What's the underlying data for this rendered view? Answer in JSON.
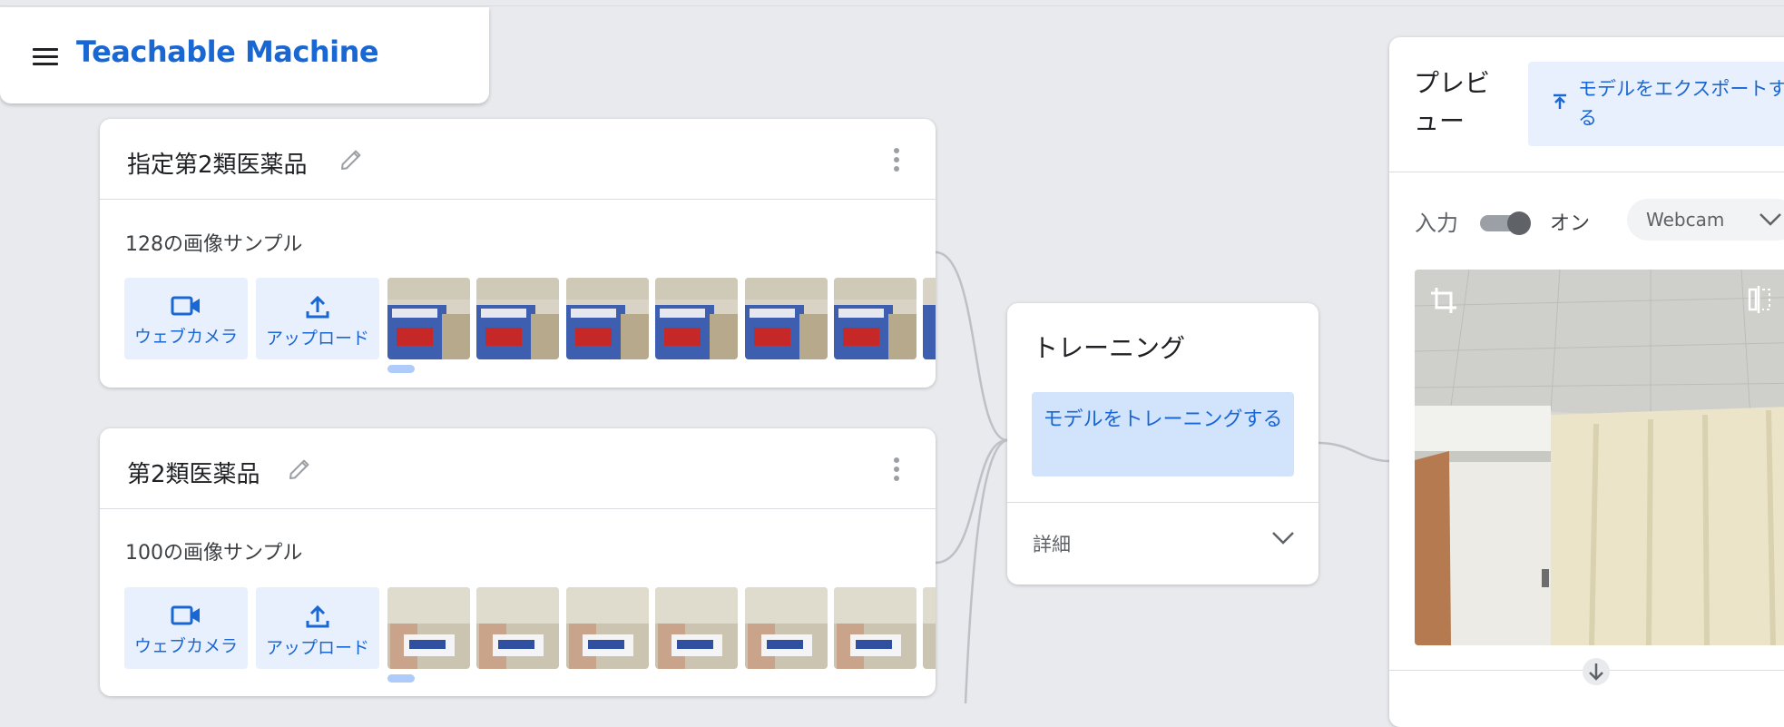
{
  "app": {
    "title": "Teachable Machine"
  },
  "classes": [
    {
      "name": "指定第2類医薬品",
      "sample_count_text": "128の画像サンプル",
      "webcam_label": "ウェブカメラ",
      "upload_label": "アップロード"
    },
    {
      "name": "第2類医薬品",
      "sample_count_text": "100の画像サンプル",
      "webcam_label": "ウェブカメラ",
      "upload_label": "アップロード"
    }
  ],
  "training": {
    "title": "トレーニング",
    "train_button": "モデルをトレーニングする",
    "details_label": "詳細"
  },
  "preview": {
    "title": "プレビュー",
    "export_button": "モデルをエクスポートする",
    "input_label": "入力",
    "toggle_state": "オン",
    "source_select": "Webcam"
  },
  "colors": {
    "accent": "#1967d2",
    "button_bg": "#e8f0fe",
    "train_button_bg": "#d2e3fc",
    "background": "#e8eaed"
  }
}
